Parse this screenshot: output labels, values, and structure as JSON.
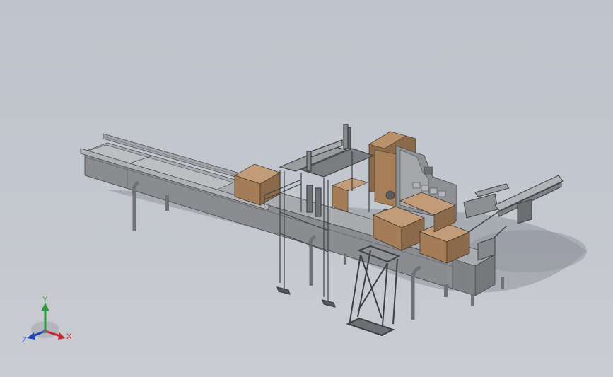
{
  "viewport": {
    "background_top": "#bfc4cc",
    "background_bottom": "#caccd2"
  },
  "model": {
    "colors": {
      "frame": "#8e8f93",
      "frame_dark": "#55575c",
      "frame_light": "#b4b6ba",
      "box_top": "#c09a77",
      "box_front": "#a37c57",
      "box_side": "#8a6848",
      "shadow": "#8c9098"
    }
  },
  "triad": {
    "x_label": "X",
    "y_label": "Y",
    "z_label": "Z",
    "x_color": "#c0282d",
    "y_color": "#2a9a3a",
    "z_color": "#2546b8"
  }
}
